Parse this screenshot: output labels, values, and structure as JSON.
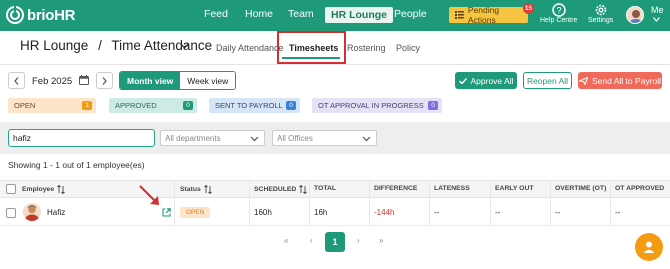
{
  "brand": {
    "name_a": "brio",
    "name_b": "HR"
  },
  "topnav": [
    {
      "label": "Feed"
    },
    {
      "label": "Home"
    },
    {
      "label": "Team"
    },
    {
      "label": "HR Lounge"
    },
    {
      "label": "People"
    }
  ],
  "pending": {
    "label": "Pending Actions",
    "count": "15"
  },
  "help": {
    "label": "Help Centre"
  },
  "settings": {
    "label": "Settings"
  },
  "user": {
    "label": "Me"
  },
  "breadcrumb": {
    "root": "HR Lounge",
    "sep": "/",
    "current": "Time Attendance"
  },
  "subtabs": [
    {
      "label": "Daily Attendance"
    },
    {
      "label": "Timesheets"
    },
    {
      "label": "Rostering"
    },
    {
      "label": "Policy"
    }
  ],
  "period": {
    "label": "Feb 2025"
  },
  "views": {
    "month": "Month view",
    "week": "Week view"
  },
  "actions": {
    "approve_all": "Approve All",
    "reopen_all": "Reopen All",
    "send_all": "Send All to Payroll"
  },
  "status_chips": [
    {
      "label": "OPEN",
      "count": "1"
    },
    {
      "label": "APPROVED",
      "count": "0"
    },
    {
      "label": "SENT TO PAYROLL",
      "count": "0"
    },
    {
      "label": "OT APPROVAL IN PROGRESS",
      "count": "0"
    }
  ],
  "filters": {
    "search_value": "hafiz",
    "department": "All departments",
    "office": "All Offices"
  },
  "showing": "Showing 1 - 1 out of 1 employee(es)",
  "table": {
    "headers": [
      "Employee",
      "Status",
      "SCHEDULED",
      "TOTAL",
      "DIFFERENCE",
      "LATENESS",
      "EARLY OUT",
      "OVERTIME (OT)",
      "OT APPROVED"
    ],
    "rows": [
      {
        "employee": "Hafiz",
        "status": "OPEN",
        "scheduled": "160h",
        "total": "16h",
        "difference": "-144h",
        "lateness": "--",
        "early_out": "--",
        "overtime": "--",
        "ot_approved": "--"
      }
    ]
  },
  "pagination": {
    "first": "«",
    "prev": "‹",
    "current": "1",
    "next": "›",
    "last": "»"
  },
  "colors": {
    "brand": "#1f9a78",
    "alert": "#d32f2f",
    "pending": "#f5c542",
    "negative": "#d32f2f"
  }
}
